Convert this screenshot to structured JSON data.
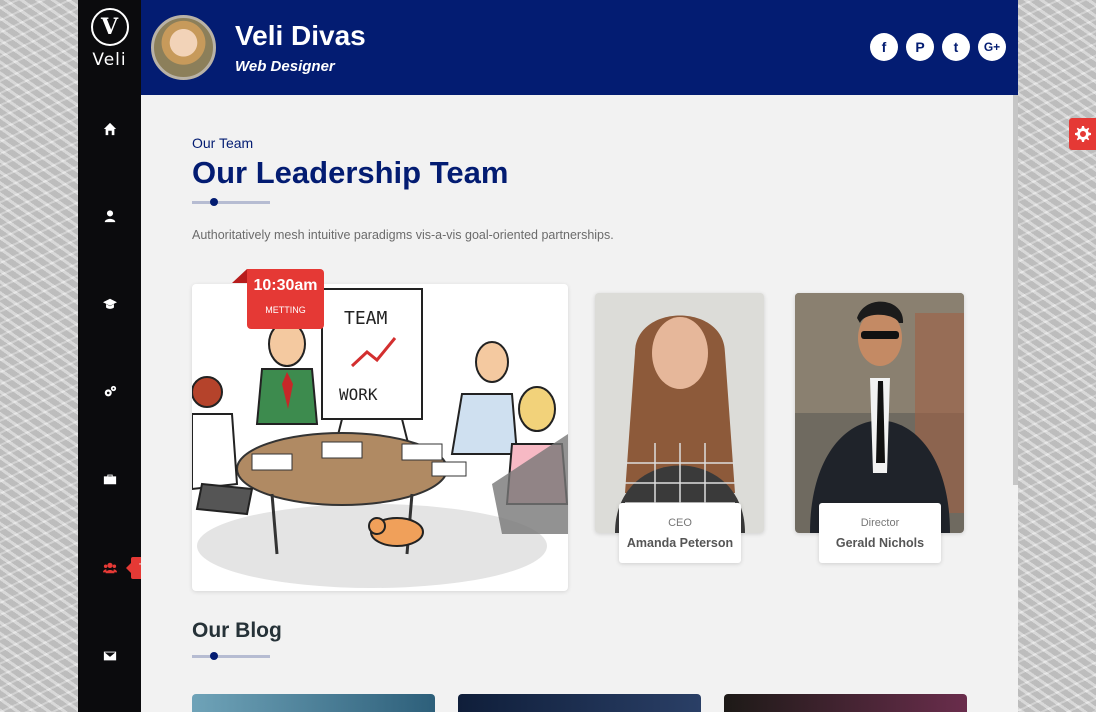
{
  "brand": {
    "logo_letter": "V",
    "logo_text": "Veli"
  },
  "profile": {
    "name": "Veli Divas",
    "role": "Web Designer"
  },
  "social": [
    {
      "icon": "facebook-icon",
      "glyph": "f"
    },
    {
      "icon": "pinterest-icon",
      "glyph": "P"
    },
    {
      "icon": "twitter-icon",
      "glyph": "t"
    },
    {
      "icon": "google-plus-icon",
      "glyph": "G+"
    }
  ],
  "nav": [
    {
      "icon": "home-icon"
    },
    {
      "icon": "user-icon"
    },
    {
      "icon": "graduation-cap-icon"
    },
    {
      "icon": "cogs-icon"
    },
    {
      "icon": "briefcase-icon"
    },
    {
      "icon": "users-icon",
      "tooltip": "Team",
      "active": true
    },
    {
      "icon": "envelope-icon"
    }
  ],
  "team_section": {
    "subtitle": "Our Team",
    "title": "Our Leadership Team",
    "description": "Authoritatively mesh intuitive paradigms vis-a-vis goal-oriented partnerships.",
    "meeting_badge": {
      "time": "10:30am",
      "label": "METTING"
    },
    "illustration_board": {
      "line1": "TEAM",
      "line2": "WORK"
    },
    "members": [
      {
        "role": "CEO",
        "name": "Amanda Peterson"
      },
      {
        "role": "Director",
        "name": "Gerald Nichols"
      }
    ]
  },
  "blog_section": {
    "title": "Our Blog"
  },
  "colors": {
    "navy": "#031c72",
    "accent": "#e53935",
    "sidebar": "#0b0b0d"
  }
}
